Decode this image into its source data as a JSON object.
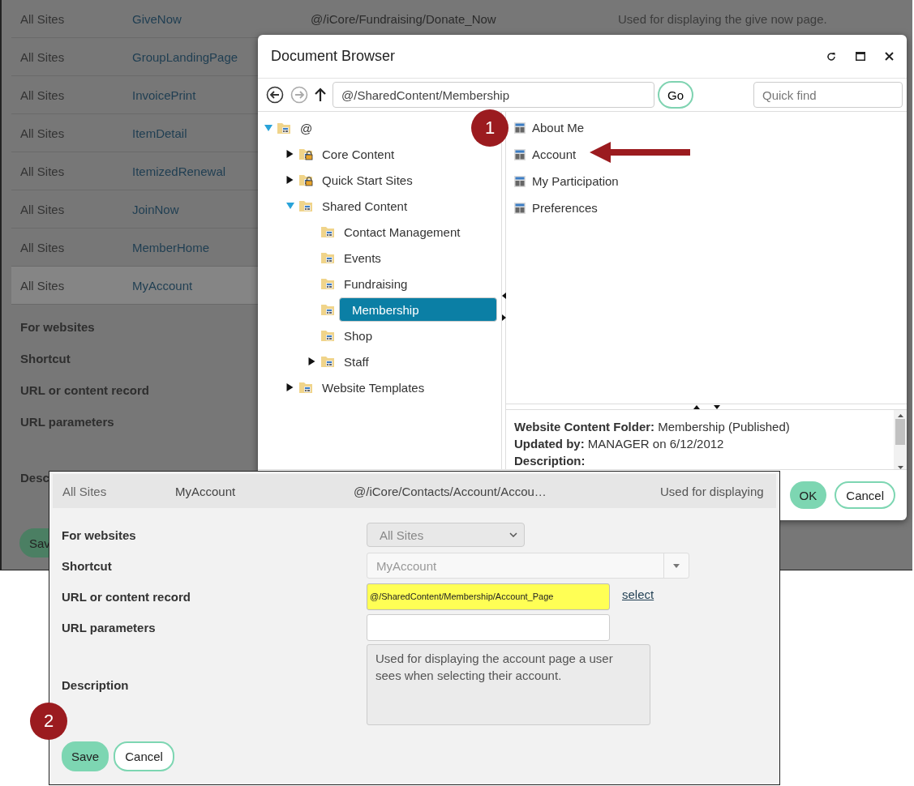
{
  "background_page": {
    "rows": [
      {
        "site": "All Sites",
        "shortcut": "GiveNow",
        "path": "@/iCore/Fundraising/Donate_Now",
        "description": "Used for displaying the give now page.",
        "selected": false
      },
      {
        "site": "All Sites",
        "shortcut": "GroupLandingPage",
        "selected": false
      },
      {
        "site": "All Sites",
        "shortcut": "InvoicePrint",
        "selected": false
      },
      {
        "site": "All Sites",
        "shortcut": "ItemDetail",
        "selected": false
      },
      {
        "site": "All Sites",
        "shortcut": "ItemizedRenewal",
        "selected": false
      },
      {
        "site": "All Sites",
        "shortcut": "JoinNow",
        "selected": false
      },
      {
        "site": "All Sites",
        "shortcut": "MemberHome",
        "selected": false
      },
      {
        "site": "All Sites",
        "shortcut": "MyAccount",
        "selected": true
      }
    ],
    "form_labels": [
      "For websites",
      "Shortcut",
      "URL or content record",
      "URL parameters",
      "Desc"
    ],
    "save_button": "Sav"
  },
  "document_browser": {
    "title": "Document Browser",
    "path": "@/SharedContent/Membership",
    "go_button": "Go",
    "quick_find": {
      "placeholder": "Quick find"
    },
    "tree": [
      {
        "label": "@",
        "kind": "open",
        "locked": false,
        "selected": false,
        "children": [
          {
            "label": "Core Content",
            "kind": "closed",
            "locked": true,
            "selected": false
          },
          {
            "label": "Quick Start Sites",
            "kind": "closed",
            "locked": true,
            "selected": false
          },
          {
            "label": "Shared Content",
            "kind": "open",
            "locked": false,
            "selected": false,
            "children": [
              {
                "label": "Contact Management",
                "kind": "leaf",
                "locked": false,
                "selected": false
              },
              {
                "label": "Events",
                "kind": "leaf",
                "locked": false,
                "selected": false
              },
              {
                "label": "Fundraising",
                "kind": "leaf",
                "locked": false,
                "selected": false
              },
              {
                "label": "Membership",
                "kind": "leaf",
                "locked": false,
                "selected": true
              },
              {
                "label": "Shop",
                "kind": "leaf",
                "locked": false,
                "selected": false
              },
              {
                "label": "Staff",
                "kind": "closed",
                "locked": false,
                "selected": false
              }
            ]
          },
          {
            "label": "Website Templates",
            "kind": "closed",
            "locked": false,
            "selected": false
          }
        ]
      }
    ],
    "items": [
      "About Me",
      "Account",
      "My Participation",
      "Preferences"
    ],
    "details": [
      {
        "label": "Website Content Folder:",
        "value": "Membership (Published)"
      },
      {
        "label": "Updated by:",
        "value": "MANAGER on 6/12/2012"
      },
      {
        "label": "Description:"
      }
    ],
    "buttons": {
      "ok": "OK",
      "cancel": "Cancel"
    }
  },
  "edit_panel": {
    "row": {
      "site": "All Sites",
      "shortcut": "MyAccount",
      "path": "@/iCore/Contacts/Account/Accou…",
      "description": "Used for displaying"
    },
    "fields": [
      {
        "label": "For websites",
        "kind": "select",
        "value": "All Sites"
      },
      {
        "label": "Shortcut",
        "kind": "combo",
        "value": "MyAccount"
      },
      {
        "label": "URL or content record",
        "kind": "url",
        "value": "@/SharedContent/Membership/Account_Page",
        "link": "select"
      },
      {
        "label": "URL parameters",
        "kind": "text"
      },
      {
        "label": "Description",
        "kind": "textarea",
        "value": "Used for displaying the account page a user sees when selecting their account."
      }
    ],
    "buttons": {
      "save": "Save",
      "cancel": "Cancel"
    }
  },
  "callouts": [
    "1",
    "2"
  ]
}
